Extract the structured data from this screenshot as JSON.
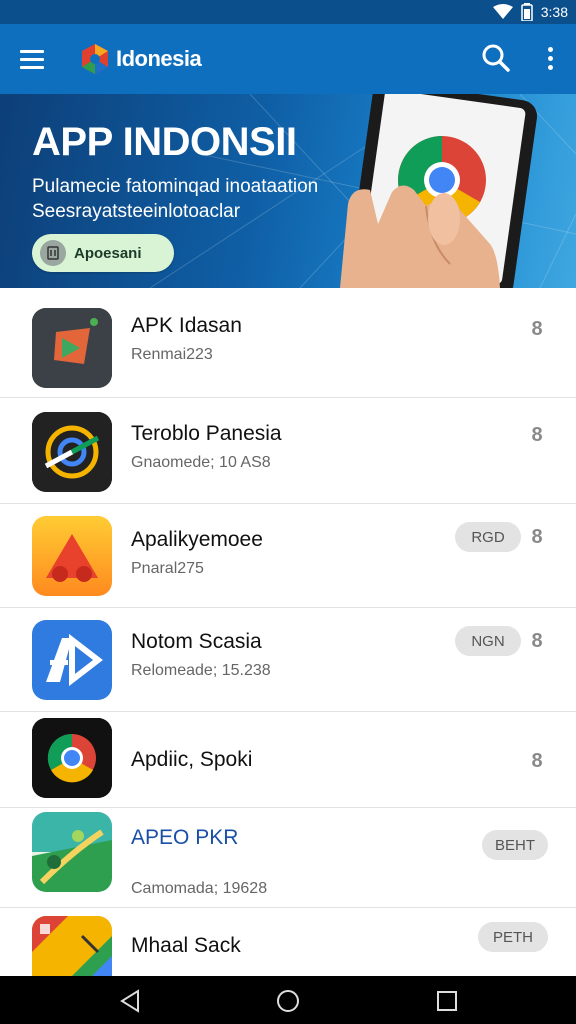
{
  "status_bar": {
    "time": "3:38"
  },
  "app_bar": {
    "brand": "Idonesia"
  },
  "banner": {
    "title": "APP INDONSII",
    "subtitle": "Pulamecie fatominqad inoataation Seesrayatsteeinlotoaclar",
    "cta_label": "Apoesani"
  },
  "apps": [
    {
      "name": "APK Idasan",
      "meta": "Renmai223",
      "badge": "",
      "action": "8"
    },
    {
      "name": "Teroblo Panesia",
      "meta": "Gnaomede; 10 AS8",
      "badge": "",
      "action": "8"
    },
    {
      "name": "Apalikyemoee",
      "meta": "Pnaral275",
      "badge": "RGD",
      "action": "8"
    },
    {
      "name": "Notom Scasia",
      "meta": "Relomeade; 15.238",
      "badge": "NGN",
      "action": "8"
    },
    {
      "name": "Apdiic, Spoki",
      "meta": "",
      "badge": "",
      "action": "8"
    },
    {
      "name": "APEO PKR",
      "meta": "Camomada; 19628",
      "badge": "BEHT",
      "action": ""
    },
    {
      "name": "Mhaal Sack",
      "meta": "",
      "badge": "PETH",
      "action": ""
    }
  ],
  "colors": {
    "app_bar": "#0f6fbf",
    "status_bar": "#0b4f8c",
    "banner_dark": "#0d3f78",
    "cta_bg": "#d9f3d5"
  },
  "icons": [
    "wifi-icon",
    "battery-icon",
    "menu-icon",
    "search-icon",
    "more-vert-icon",
    "back-icon",
    "home-icon",
    "recents-icon"
  ]
}
